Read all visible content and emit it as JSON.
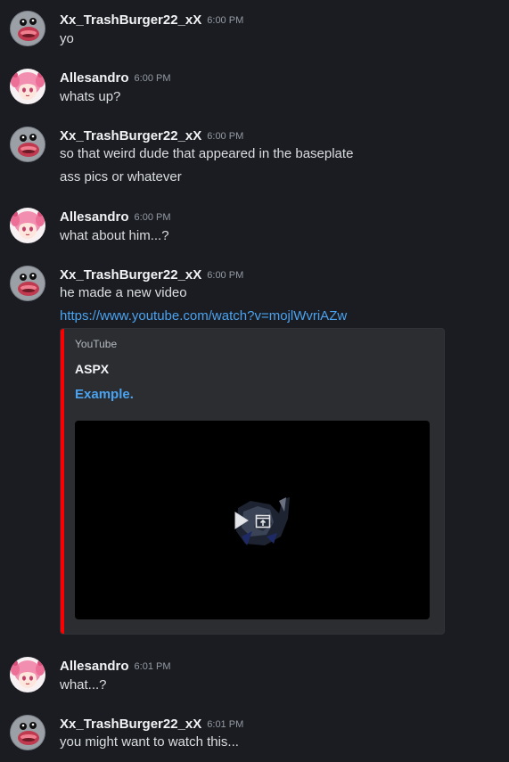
{
  "users": {
    "trash": "Xx_TrashBurger22_xX",
    "alle": "Allesandro"
  },
  "messages": [
    {
      "author": "Xx_TrashBurger22_xX",
      "time": "6:00 PM",
      "lines": [
        "yo"
      ]
    },
    {
      "author": "Allesandro",
      "time": "6:00 PM",
      "lines": [
        "whats up?"
      ]
    },
    {
      "author": "Xx_TrashBurger22_xX",
      "time": "6:00 PM",
      "lines": [
        "so that weird dude that appeared in the baseplate",
        "ass pics or whatever"
      ]
    },
    {
      "author": "Allesandro",
      "time": "6:00 PM",
      "lines": [
        "what about him...?"
      ]
    },
    {
      "author": "Xx_TrashBurger22_xX",
      "time": "6:00 PM",
      "lines": [
        "he made a new video"
      ],
      "link": "https://www.youtube.com/watch?v=mojlWvriAZw"
    },
    {
      "author": "Allesandro",
      "time": "6:01 PM",
      "lines": [
        "what...?"
      ]
    },
    {
      "author": "Xx_TrashBurger22_xX",
      "time": "6:01 PM",
      "lines": [
        "you might want to watch this..."
      ]
    }
  ],
  "embed": {
    "provider": "YouTube",
    "author": "ASPX",
    "title": "Example.",
    "accent_color": "#ff0000",
    "icons": [
      "play-icon",
      "open-external-icon"
    ]
  },
  "colors": {
    "background": "#1b1c21",
    "username": "#f2f3f5",
    "timestamp": "#949ba4",
    "text": "#dbdee1",
    "link": "#4aa3f0",
    "embed_bg": "#2b2d31"
  }
}
